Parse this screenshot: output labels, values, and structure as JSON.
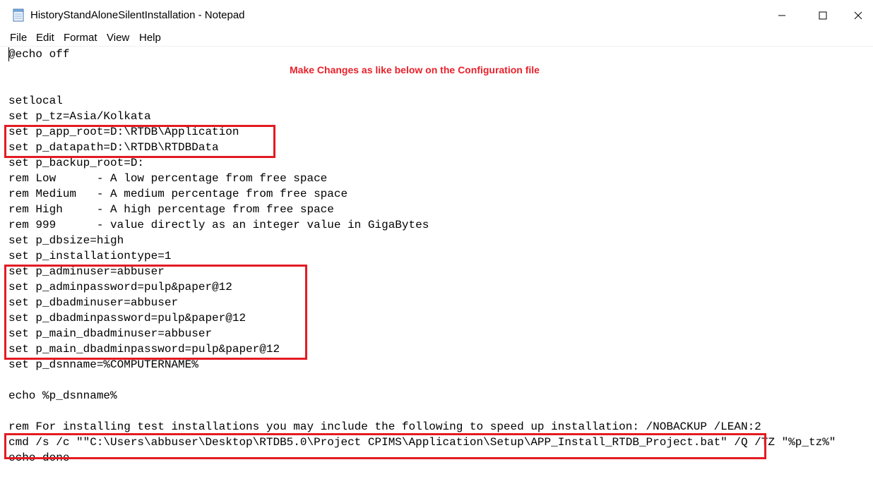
{
  "window": {
    "title": "HistoryStandAloneSilentInstallation - Notepad"
  },
  "menu": [
    "File",
    "Edit",
    "Format",
    "View",
    "Help"
  ],
  "annotation": "Make Changes as like below on the Configuration file",
  "lines": [
    "@echo off",
    "",
    "",
    "setlocal",
    "set p_tz=Asia/Kolkata",
    "set p_app_root=D:\\RTDB\\Application",
    "set p_datapath=D:\\RTDB\\RTDBData",
    "set p_backup_root=D:",
    "rem Low      - A low percentage from free space",
    "rem Medium   - A medium percentage from free space",
    "rem High     - A high percentage from free space",
    "rem 999      - value directly as an integer value in GigaBytes",
    "set p_dbsize=high",
    "set p_installationtype=1",
    "set p_adminuser=abbuser",
    "set p_adminpassword=pulp&paper@12",
    "set p_dbadminuser=abbuser",
    "set p_dbadminpassword=pulp&paper@12",
    "set p_main_dbadminuser=abbuser",
    "set p_main_dbadminpassword=pulp&paper@12",
    "set p_dsnname=%COMPUTERNAME%",
    "",
    "echo %p_dsnname%",
    "",
    "rem For installing test installations you may include the following to speed up installation: /NOBACKUP /LEAN:2",
    "cmd /s /c \"\"C:\\Users\\abbuser\\Desktop\\RTDB5.0\\Project CPIMS\\Application\\Setup\\APP_Install_RTDB_Project.bat\" /Q /TZ \"%p_tz%\"",
    "echo done"
  ],
  "colors": {
    "highlight": "#e31b23",
    "annotation": "#e8212a"
  }
}
